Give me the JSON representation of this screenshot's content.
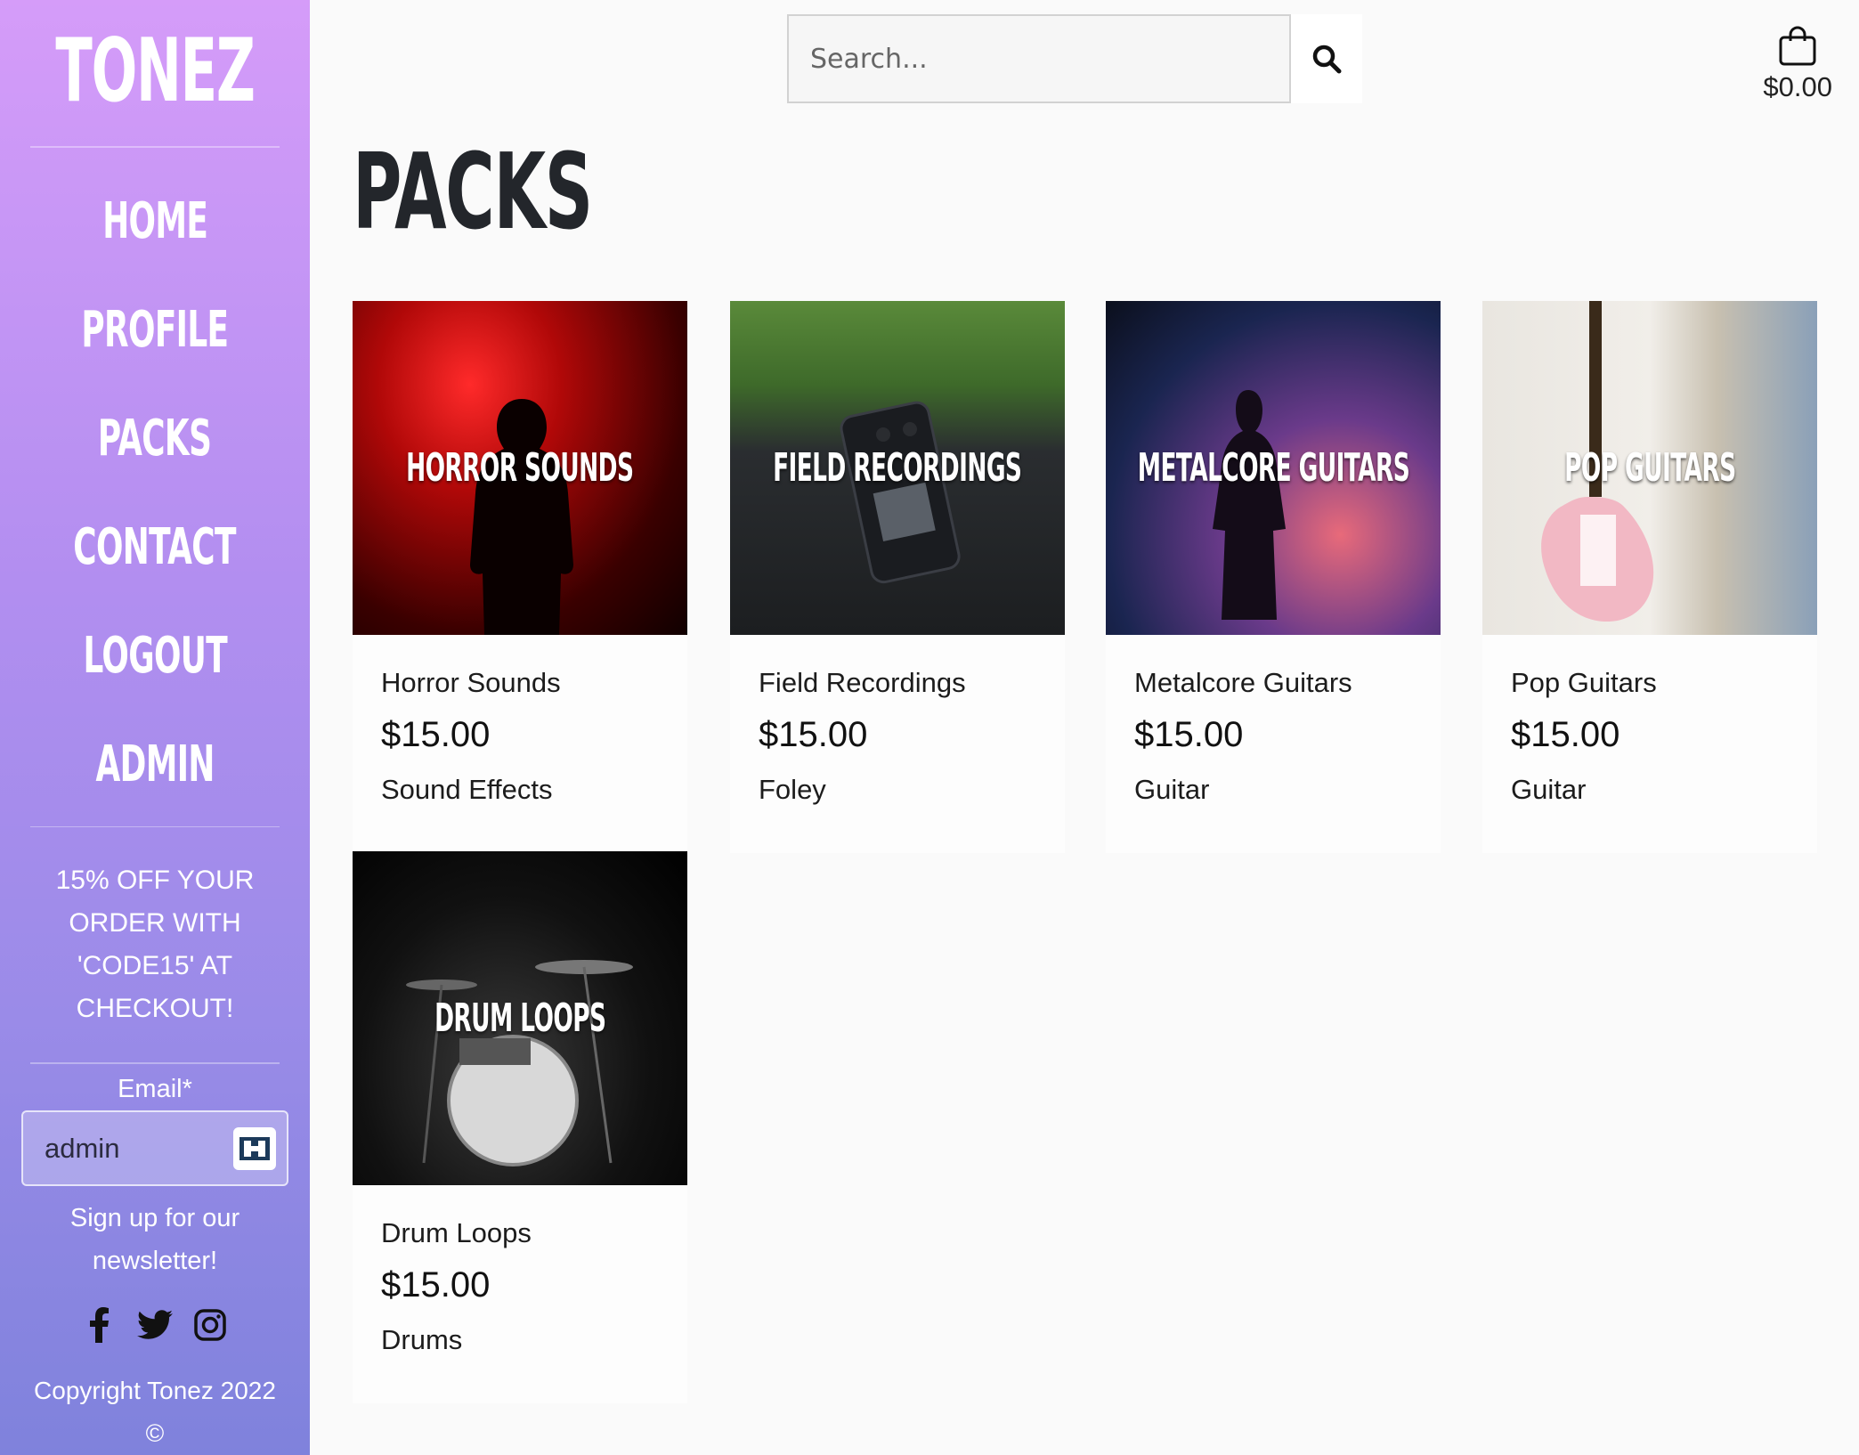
{
  "sidebar": {
    "brand": "TONEZ",
    "nav": [
      "HOME",
      "PROFILE",
      "PACKS",
      "CONTACT",
      "LOGOUT",
      "ADMIN"
    ],
    "promo": "15% OFF YOUR ORDER WITH 'CODE15' AT CHECKOUT!",
    "email_label": "Email*",
    "email_value": "admin",
    "signup": "Sign up for our newsletter!",
    "socials": [
      "facebook-icon",
      "twitter-icon",
      "instagram-icon"
    ],
    "copyright": "Copyright Tonez 2022 ©"
  },
  "header": {
    "search_placeholder": "Search...",
    "cart_total": "$0.00"
  },
  "page_title": "PACKS",
  "products": [
    {
      "overlay": "HORROR SOUNDS",
      "name": "Horror Sounds",
      "price": "$15.00",
      "category": "Sound Effects"
    },
    {
      "overlay": "FIELD RECORDINGS",
      "name": "Field Recordings",
      "price": "$15.00",
      "category": "Foley"
    },
    {
      "overlay": "METALCORE GUITARS",
      "name": "Metalcore Guitars",
      "price": "$15.00",
      "category": "Guitar"
    },
    {
      "overlay": "POP GUITARS",
      "name": "Pop Guitars",
      "price": "$15.00",
      "category": "Guitar"
    },
    {
      "overlay": "DRUM LOOPS",
      "name": "Drum Loops",
      "price": "$15.00",
      "category": "Drums"
    }
  ],
  "colors": {
    "sidebar_top": "#d59cf9",
    "sidebar_bottom": "#7f82dc",
    "page_bg": "#fafafa",
    "title": "#23262b"
  }
}
